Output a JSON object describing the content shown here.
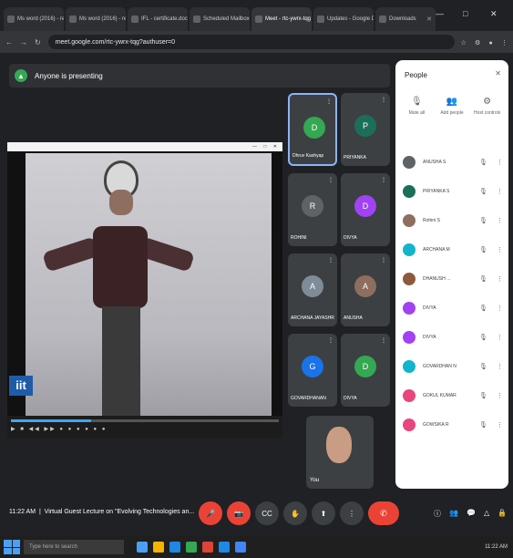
{
  "browser": {
    "tabs": [
      {
        "title": "Ms word (2016) - review",
        "active": false
      },
      {
        "title": "Ms word (2016) - review",
        "active": false
      },
      {
        "title": "IFL - certificate.docx",
        "active": false
      },
      {
        "title": "Scheduled Mailbox",
        "active": false
      },
      {
        "title": "Meet - rtc-ywrx-tqg",
        "active": true
      },
      {
        "title": "Updates - Google Drive",
        "active": false
      },
      {
        "title": "Downloads",
        "active": false
      }
    ],
    "url": "meet.google.com/rtc-ywrx-tqg?authuser=0",
    "window_controls": [
      "—",
      "□",
      "✕"
    ]
  },
  "meet": {
    "presenting_banner": "Anyone is presenting",
    "video_progress": 0.3,
    "video_logo": "iit",
    "tiles": [
      {
        "name": "Dhruv Kashyap",
        "initial": "D",
        "color": "#34a853",
        "active": true
      },
      {
        "name": "PRIYANKA",
        "initial": "P",
        "color": "#1b6f5a",
        "active": false
      },
      {
        "name": "ROHINI",
        "initial": "R",
        "color": "#5f6368",
        "active": false
      },
      {
        "name": "DIVYA",
        "initial": "D",
        "color": "#a142f4",
        "active": false
      },
      {
        "name": "ARCHANA JAYASHREE",
        "initial": "A",
        "color": "#7e8c98",
        "active": false
      },
      {
        "name": "ANUSHA",
        "initial": "A",
        "color": "#8d6e5f",
        "active": false
      },
      {
        "name": "GOVARDHANAN",
        "initial": "G",
        "color": "#1a73e8",
        "active": false
      },
      {
        "name": "DIVYA",
        "initial": "D",
        "color": "#34a853",
        "active": false
      }
    ],
    "self_tile": {
      "name": "You"
    },
    "time": "11:22 AM",
    "meeting_title": "Virtual Guest Lecture on \"Evolving Technologies an...",
    "controls": [
      "mic",
      "cam",
      "cc",
      "raise",
      "present",
      "more"
    ],
    "end_label": "✆",
    "right_controls": [
      "info",
      "people",
      "chat",
      "activities",
      "lock"
    ]
  },
  "people_panel": {
    "title": "People",
    "close": "✕",
    "actions": [
      {
        "icon": "🎙",
        "label": "Mute all"
      },
      {
        "icon": "👥",
        "label": "Add people"
      },
      {
        "icon": "⚙",
        "label": "Host controls"
      }
    ],
    "participants": [
      {
        "name": "ANUSHA S",
        "color": "#5f6368"
      },
      {
        "name": "PRIYANKA S",
        "color": "#1b6f5a"
      },
      {
        "name": "Rohini S",
        "color": "#8d6e5f"
      },
      {
        "name": "ARCHANA M",
        "color": "#12b5cb"
      },
      {
        "name": "DHANUSH ...",
        "color": "#8d5b3c"
      },
      {
        "name": "DIVYA",
        "color": "#a142f4"
      },
      {
        "name": "DIVYA",
        "color": "#a142f4"
      },
      {
        "name": "GOVARDHAN N",
        "color": "#12b5cb"
      },
      {
        "name": "GOKUL KUMAR",
        "color": "#e8467c"
      },
      {
        "name": "GOWSIKA R",
        "color": "#e8467c"
      }
    ]
  },
  "taskbar": {
    "search_placeholder": "Type here to search",
    "apps": [
      "#4aa1f3",
      "#f4b400",
      "#1e88e5",
      "#34a853",
      "#db4437",
      "#1e88e5",
      "#4285f4"
    ],
    "clock": "11:22 AM"
  }
}
